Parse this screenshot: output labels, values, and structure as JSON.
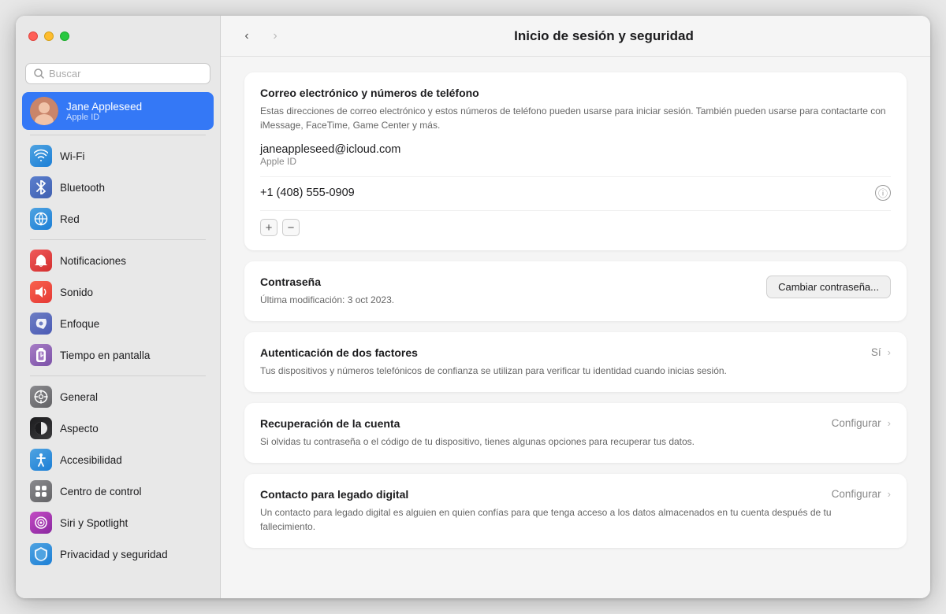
{
  "window": {
    "title": "Inicio de sesión y seguridad"
  },
  "sidebar": {
    "search_placeholder": "Buscar",
    "user": {
      "name": "Jane Appleseed",
      "sublabel": "Apple ID"
    },
    "items": [
      {
        "id": "wifi",
        "label": "Wi-Fi",
        "icon": "wifi",
        "color": "ic-wifi"
      },
      {
        "id": "bluetooth",
        "label": "Bluetooth",
        "icon": "bluetooth",
        "color": "ic-bluetooth"
      },
      {
        "id": "red",
        "label": "Red",
        "icon": "globe",
        "color": "ic-red"
      },
      {
        "id": "notificaciones",
        "label": "Notificaciones",
        "icon": "bell",
        "color": "ic-notif"
      },
      {
        "id": "sonido",
        "label": "Sonido",
        "icon": "sound",
        "color": "ic-sound"
      },
      {
        "id": "enfoque",
        "label": "Enfoque",
        "icon": "moon",
        "color": "ic-focus"
      },
      {
        "id": "tiempo",
        "label": "Tiempo en pantalla",
        "icon": "hourglass",
        "color": "ic-screen"
      },
      {
        "id": "general",
        "label": "General",
        "icon": "gear",
        "color": "ic-general"
      },
      {
        "id": "aspecto",
        "label": "Aspecto",
        "icon": "eye",
        "color": "ic-aspect"
      },
      {
        "id": "accesibilidad",
        "label": "Accesibilidad",
        "icon": "accessibility",
        "color": "ic-access"
      },
      {
        "id": "control",
        "label": "Centro de control",
        "icon": "control",
        "color": "ic-control"
      },
      {
        "id": "siri",
        "label": "Siri y Spotlight",
        "icon": "siri",
        "color": "ic-siri"
      },
      {
        "id": "privacidad",
        "label": "Privacidad y seguridad",
        "icon": "hand",
        "color": "ic-privacy"
      }
    ]
  },
  "main": {
    "title": "Inicio de sesión y seguridad",
    "nav_back": "‹",
    "nav_forward": "›",
    "sections": {
      "email_section": {
        "title": "Correo electrónico y números de teléfono",
        "desc": "Estas direcciones de correo electrónico y estos números de teléfono pueden usarse para iniciar sesión. También pueden usarse para contactarte con iMessage, FaceTime, Game Center y más.",
        "email": "janeappleseed@icloud.com",
        "email_sublabel": "Apple ID",
        "phone": "+1 (408) 555-0909",
        "add_btn": "+",
        "remove_btn": "−"
      },
      "password_section": {
        "title": "Contraseña",
        "last_changed": "Última modificación: 3 oct 2023.",
        "change_btn": "Cambiar contraseña..."
      },
      "two_factor": {
        "title": "Autenticación de dos factores",
        "desc": "Tus dispositivos y números telefónicos de confianza se utilizan para verificar tu identidad cuando inicias sesión.",
        "status": "Sí"
      },
      "recovery": {
        "title": "Recuperación de la cuenta",
        "desc": "Si olvidas tu contraseña o el código de tu dispositivo, tienes algunas opciones para recuperar tus datos.",
        "action": "Configurar"
      },
      "legacy": {
        "title": "Contacto para legado digital",
        "desc": "Un contacto para legado digital es alguien en quien confías para que tenga acceso a los datos almacenados en tu cuenta después de tu fallecimiento.",
        "action": "Configurar"
      }
    }
  },
  "icons": {
    "wifi": "📶",
    "bluetooth": "🔵",
    "globe": "🌐",
    "bell": "🔔",
    "sound": "🔊",
    "moon": "🌙",
    "hourglass": "⌛",
    "gear": "⚙️",
    "eye": "👁",
    "accessibility": "♿",
    "control": "🎛",
    "siri": "🌀",
    "hand": "✋"
  }
}
